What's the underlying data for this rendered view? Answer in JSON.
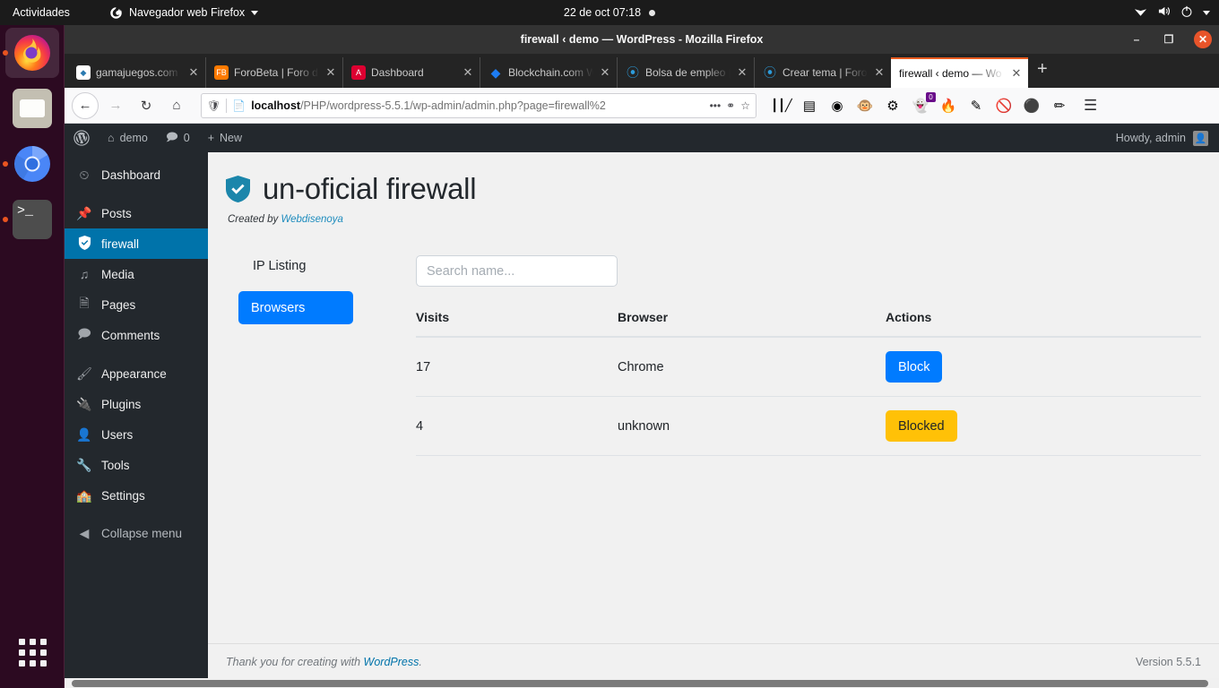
{
  "os_bar": {
    "activities": "Actividades",
    "app_menu": "Navegador web Firefox",
    "clock": "22 de oct  07:18",
    "icons": [
      "wifi-icon",
      "volume-icon",
      "power-icon",
      "caret-down-icon"
    ]
  },
  "dock": {
    "items": [
      {
        "name": "firefox",
        "label": "Firefox",
        "running": true,
        "active": true
      },
      {
        "name": "files",
        "label": "Archivos",
        "running": false,
        "active": false
      },
      {
        "name": "chromium",
        "label": "Chromium",
        "running": true,
        "active": false
      },
      {
        "name": "terminal",
        "label": "Terminal",
        "running": true,
        "active": false
      }
    ],
    "app_grid_label": "Mostrar aplicaciones"
  },
  "browser": {
    "window_title": "firewall ‹ demo — WordPress - Mozilla Firefox",
    "window_buttons": {
      "minimize": "–",
      "maximize": "❐",
      "close": "✕"
    },
    "tabs": [
      {
        "title": "gamajuegos.com -",
        "favicon": "gamajuegos-icon",
        "fav_color": "#ffffff",
        "fav_text": "",
        "active": false
      },
      {
        "title": "ForoBeta | Foro de",
        "favicon": "forobeta-icon",
        "fav_color": "#ff7a00",
        "fav_text": "FB",
        "active": false
      },
      {
        "title": "Dashboard",
        "favicon": "angular-icon",
        "fav_color": "#dd0031",
        "fav_text": "A",
        "active": false
      },
      {
        "title": "Blockchain.com W",
        "favicon": "blockchain-icon",
        "fav_color": "#1d7cf2",
        "fav_text": "◆",
        "active": false
      },
      {
        "title": "Bolsa de empleo |",
        "favicon": "forobeta-alt-icon",
        "fav_color": "#2d9cdb",
        "fav_text": "@",
        "active": false
      },
      {
        "title": "Crear tema | Foro",
        "favicon": "forobeta-alt-icon",
        "fav_color": "#2d9cdb",
        "fav_text": "@",
        "active": false
      },
      {
        "title": "firewall ‹ demo — Wo",
        "favicon": "wordpress-icon",
        "fav_color": "#ffffff",
        "fav_text": "",
        "active": true
      }
    ],
    "new_tab_label": "+",
    "nav": {
      "back": "←",
      "forward": "→",
      "reload": "↻",
      "home": "⌂"
    },
    "url": {
      "shield_icon": "tracking-protection-icon",
      "page_icon": "page-icon",
      "host": "localhost",
      "path": "/PHP/wordpress-5.5.1/wp-admin/admin.php?page=firewall%2",
      "more_icon": "•••",
      "pocket_icon": "pocket-icon",
      "bookmark_icon": "star-icon"
    },
    "extensions": [
      {
        "name": "library-icon",
        "glyph": "|||\\",
        "badge": ""
      },
      {
        "name": "sidebar-icon",
        "glyph": "▤",
        "badge": ""
      },
      {
        "name": "account-icon",
        "glyph": "◎",
        "badge": ""
      },
      {
        "name": "monkey-extension-icon",
        "glyph": "🐵",
        "badge": ""
      },
      {
        "name": "wheel-extension-icon",
        "glyph": "⚙",
        "badge": ""
      },
      {
        "name": "ghostery-icon",
        "glyph": "👻",
        "badge": "0"
      },
      {
        "name": "flame-extension-icon",
        "glyph": "🔥",
        "badge": ""
      },
      {
        "name": "eyedropper-icon",
        "glyph": "✐",
        "badge": ""
      },
      {
        "name": "adblock-icon",
        "glyph": "⊘",
        "badge": ""
      },
      {
        "name": "duckduckgo-icon",
        "glyph": "●",
        "badge": ""
      },
      {
        "name": "pencil-extension-icon",
        "glyph": "✒",
        "badge": ""
      }
    ],
    "menu_icon": "☰"
  },
  "admin_bar": {
    "wp_logo": "wordpress-logo-icon",
    "site_name": "demo",
    "comments_count": "0",
    "new_label": "New",
    "howdy": "Howdy, admin"
  },
  "sidebar": {
    "items": [
      {
        "label": "Dashboard",
        "icon": "dashboard-icon",
        "glyph": "◔",
        "current": false
      },
      {
        "label": "Posts",
        "icon": "pin-icon",
        "glyph": "✎",
        "current": false
      },
      {
        "label": "firewall",
        "icon": "shield-icon",
        "glyph": "⛊",
        "current": true
      },
      {
        "label": "Media",
        "icon": "media-icon",
        "glyph": "♫",
        "current": false
      },
      {
        "label": "Pages",
        "icon": "pages-icon",
        "glyph": "❐",
        "current": false
      },
      {
        "label": "Comments",
        "icon": "comment-icon",
        "glyph": "⬛",
        "current": false
      },
      {
        "label": "Appearance",
        "icon": "brush-icon",
        "glyph": "✐",
        "current": false
      },
      {
        "label": "Plugins",
        "icon": "plug-icon",
        "glyph": "⚡",
        "current": false
      },
      {
        "label": "Users",
        "icon": "user-icon",
        "glyph": "●",
        "current": false
      },
      {
        "label": "Tools",
        "icon": "wrench-icon",
        "glyph": "⚒",
        "current": false
      },
      {
        "label": "Settings",
        "icon": "settings-icon",
        "glyph": "⚙",
        "current": false
      }
    ],
    "collapse": {
      "label": "Collapse menu",
      "icon": "collapse-icon",
      "glyph": "◀"
    }
  },
  "page": {
    "title": "un-oficial firewall",
    "shield_icon": "shield-check-icon",
    "shield_color": "#1b86ab",
    "credit_prefix": "Created by ",
    "credit_link": "Webdisenoya",
    "left_nav": {
      "ip_listing_label": "IP Listing",
      "browsers_label": "Browsers",
      "browsers_color": "#007bff"
    },
    "search": {
      "placeholder": "Search name...",
      "value": ""
    },
    "table": {
      "headers": [
        "Visits",
        "Browser",
        "Actions"
      ],
      "rows": [
        {
          "visits": "17",
          "browser": "Chrome",
          "action_label": "Block",
          "action_state": "block",
          "action_color": "#007bff"
        },
        {
          "visits": "4",
          "browser": "unknown",
          "action_label": "Blocked",
          "action_state": "blocked",
          "action_color": "#ffc107"
        }
      ]
    }
  },
  "footer": {
    "thanks_prefix": "Thank you for creating with ",
    "thanks_link": "WordPress",
    "thanks_suffix": ".",
    "version": "Version 5.5.1"
  }
}
